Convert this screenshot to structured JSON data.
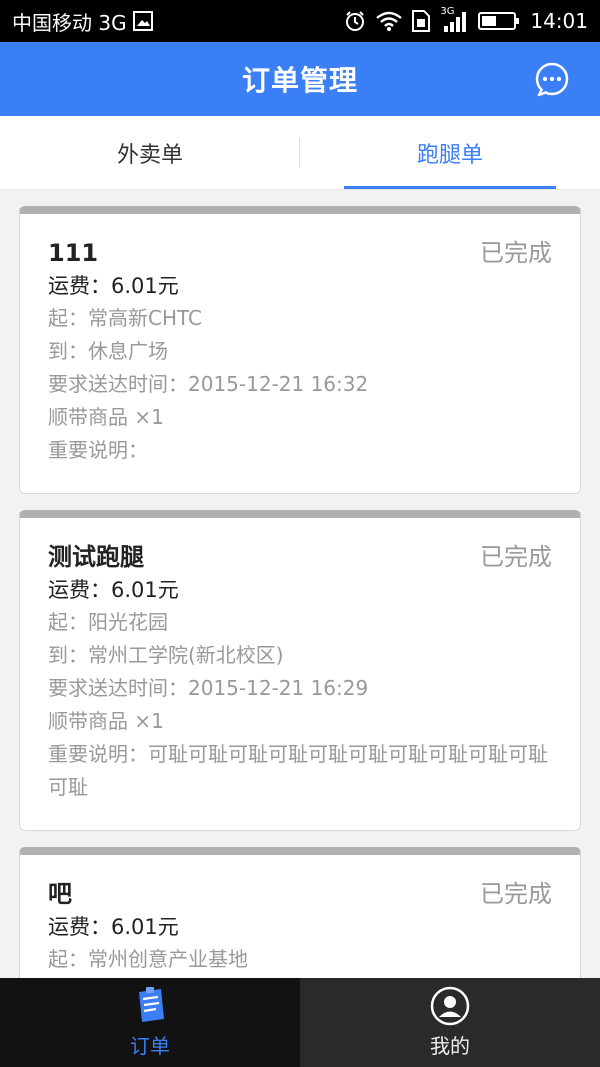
{
  "status_bar": {
    "carrier": "中国移动 3G",
    "time": "14:01",
    "network": "3G"
  },
  "header": {
    "title": "订单管理"
  },
  "tabs": [
    {
      "label": "外卖单",
      "active": false
    },
    {
      "label": "跑腿单",
      "active": true
    }
  ],
  "orders": [
    {
      "name": "111",
      "status": "已完成",
      "fee": "运费：6.01元",
      "from": "起：常高新CHTC",
      "to": "到：休息广场",
      "time": "要求送达时间：2015-12-21 16:32",
      "goods": "顺带商品 ×1",
      "note": "重要说明："
    },
    {
      "name": "测试跑腿",
      "status": "已完成",
      "fee": "运费：6.01元",
      "from": "起：阳光花园",
      "to": "到：常州工学院(新北校区)",
      "time": "要求送达时间：2015-12-21 16:29",
      "goods": "顺带商品 ×1",
      "note": "重要说明：可耻可耻可耻可耻可耻可耻可耻可耻可耻可耻可耻"
    },
    {
      "name": "吧",
      "status": "已完成",
      "fee": "运费：6.01元",
      "from": "起：常州创意产业基地"
    }
  ],
  "bottom_nav": [
    {
      "label": "订单",
      "active": true,
      "icon": "order-list-icon"
    },
    {
      "label": "我的",
      "active": false,
      "icon": "profile-icon"
    }
  ],
  "colors": {
    "primary": "#3a7ff5",
    "status_text": "#999999",
    "nav_bg": "#1b1b1b"
  }
}
